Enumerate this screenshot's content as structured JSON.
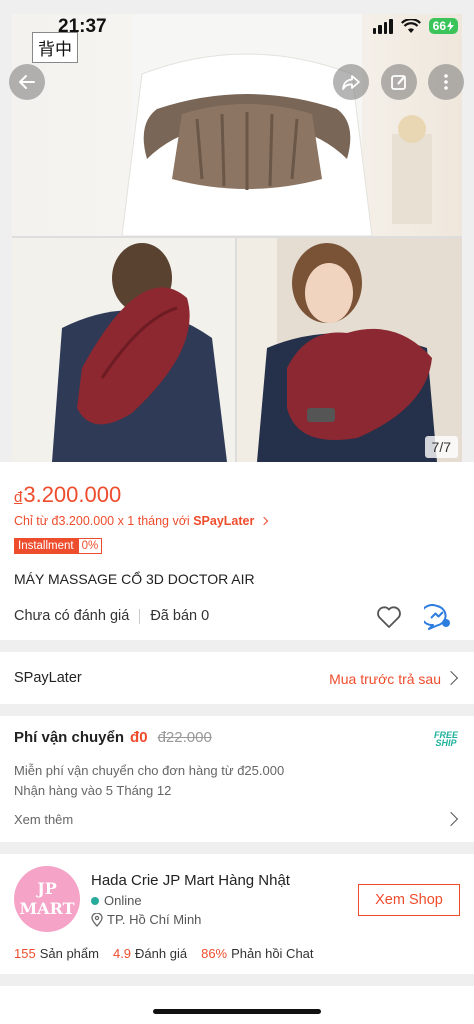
{
  "status_bar": {
    "time": "21:37",
    "battery": "66",
    "lang_badge": "背中"
  },
  "gallery": {
    "counter": "7/7"
  },
  "product": {
    "price_currency": "đ",
    "price_value": "3.200.000",
    "spaylater_prefix": "Chỉ từ đ3.200.000 x 1 tháng với ",
    "spaylater_brand": "SPayLater",
    "installment_label": "Installment",
    "installment_rate": "0%",
    "title": "MÁY MASSAGE CỔ 3D DOCTOR AIR",
    "no_rating": "Chưa có đánh giá",
    "sold": "Đã bán 0"
  },
  "spaylater_row": {
    "label": "SPayLater",
    "action": "Mua trước trả sau"
  },
  "shipping": {
    "label": "Phí vận chuyển",
    "fee": "đ0",
    "old_fee": "đ22.000",
    "badge_line1": "FREE",
    "badge_line2": "SHIP",
    "desc1": "Miễn phí vận chuyển cho đơn hàng từ đ25.000",
    "desc2": "Nhận hàng vào 5 Tháng 12",
    "more": "Xem thêm"
  },
  "shop": {
    "logo_line1": "JP",
    "logo_line2": "MART",
    "name": "Hada Crie JP Mart Hàng Nhật",
    "status": "Online",
    "location": "TP. Hồ Chí Minh",
    "button": "Xem Shop",
    "products_count": "155",
    "products_label": "Sản phẩm",
    "rating_value": "4.9",
    "rating_label": "Đánh giá",
    "chat_rate": "86%",
    "chat_label": "Phản hồi Chat"
  },
  "colors": {
    "accent": "#ee4d2d",
    "teal": "#26aa99",
    "freeship": "#1fb19c"
  }
}
